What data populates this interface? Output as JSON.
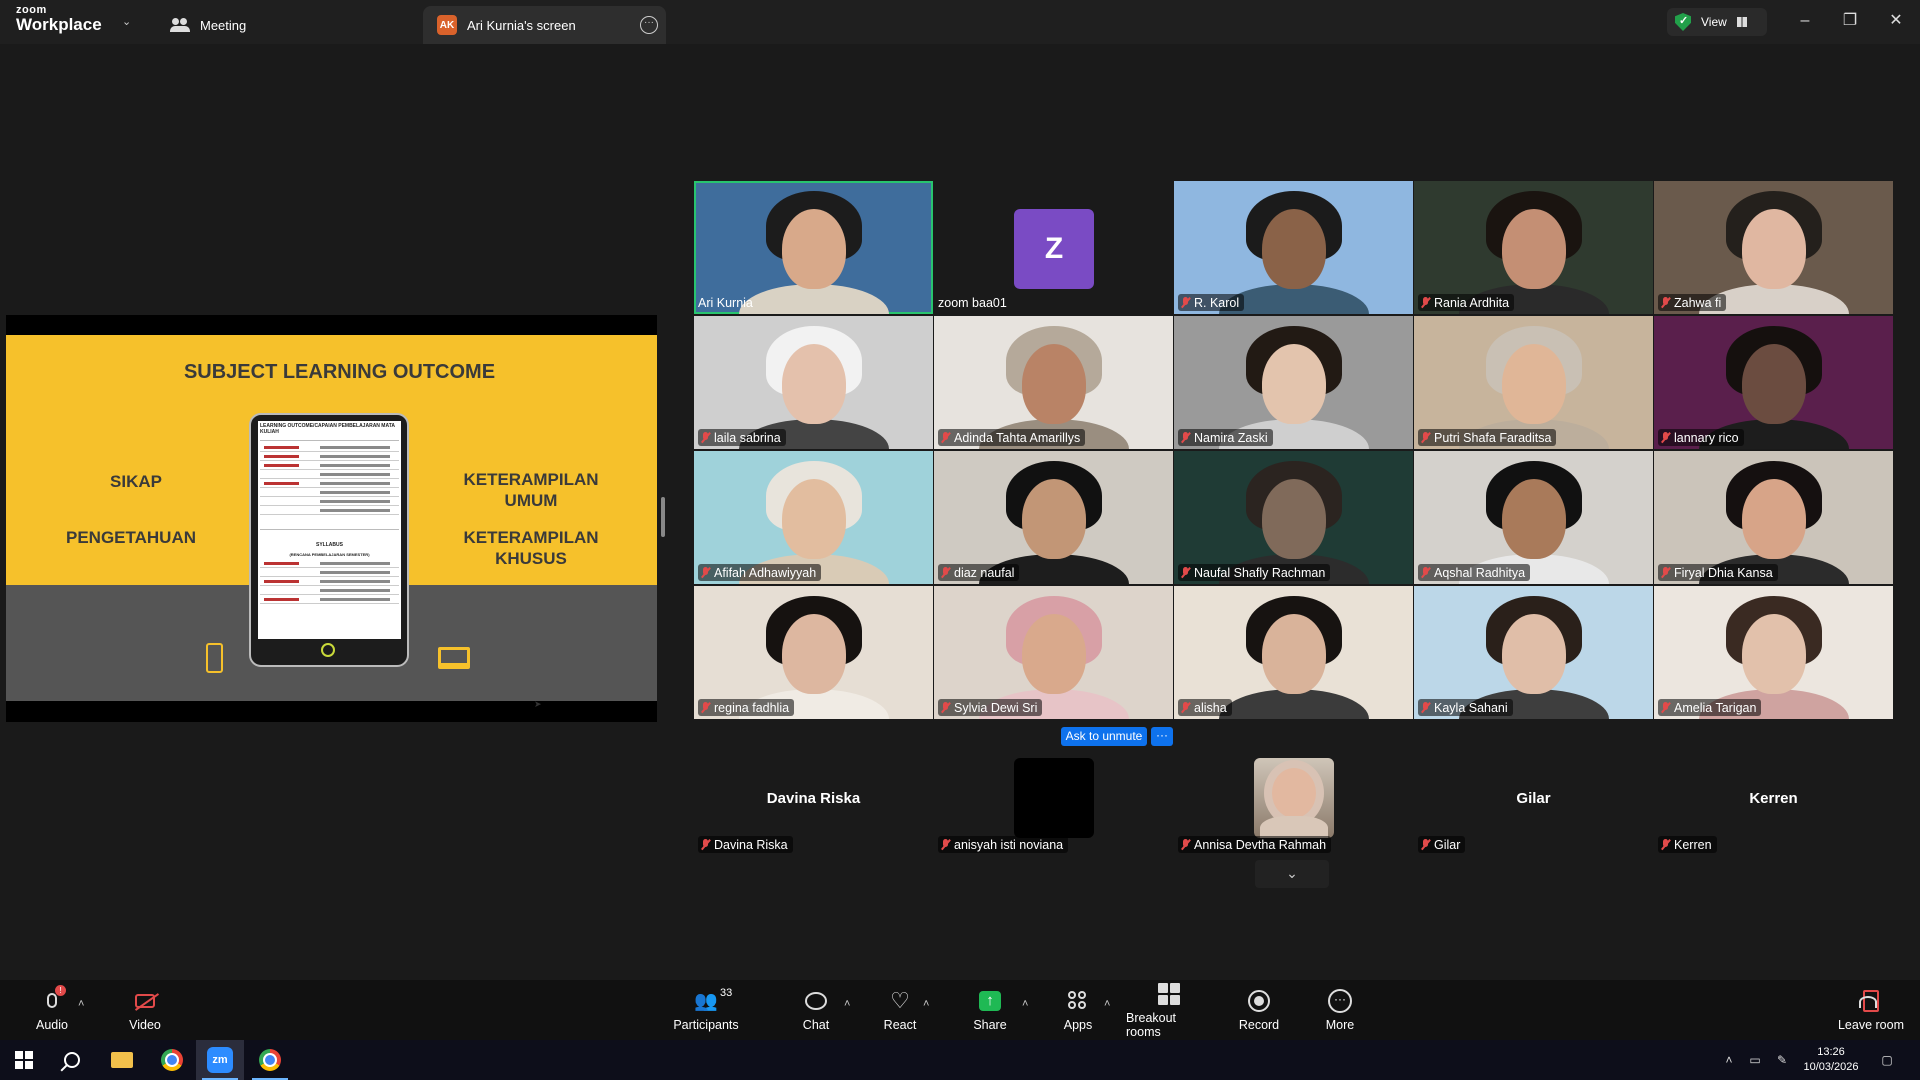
{
  "app": {
    "brand_top": "zoom",
    "brand_bottom": "Workplace",
    "tab_meeting": "Meeting",
    "tab_screen": "Ari Kurnia's screen",
    "screen_badge": "AK",
    "view_label": "View"
  },
  "slide": {
    "title": "SUBJECT LEARNING OUTCOME",
    "left_top": "SIKAP",
    "left_bottom": "PENGETAHUAN",
    "right_top": "KETERAMPILAN UMUM",
    "right_bottom": "KETERAMPILAN KHUSUS",
    "doc_header": "LEARNING OUTCOME/CAPAIAN PEMBELAJARAN MATA KULIAH",
    "doc_syllabus": "SYLLABUS",
    "doc_syllabus_sub": "(RENCANA PEMBELAJARAN SEMESTER)"
  },
  "gallery": [
    {
      "name": "Ari Kurnia",
      "muted": false,
      "active": true,
      "bg": "#3f6d9c",
      "skin": "#d8a98a",
      "hair": "#1c1c1c",
      "shirt": "#d9d2c4"
    },
    {
      "name": "zoom baa01",
      "muted": false,
      "avatar": "Z",
      "bg": "#1a1a1a"
    },
    {
      "name": "R. Karol",
      "muted": true,
      "bg": "#8fb7e0",
      "skin": "#8a6248",
      "hair": "#1b1b1b",
      "shirt": "#3b5c74"
    },
    {
      "name": "Rania Ardhita",
      "muted": true,
      "bg": "#2f3a2f",
      "skin": "#c48f74",
      "hair": "#1a1410",
      "shirt": "#2a2a2a"
    },
    {
      "name": "Zahwa fi",
      "muted": true,
      "bg": "#6a5a4c",
      "skin": "#e0b7a1",
      "hair": "#24201c",
      "shirt": "#d8d0c8"
    },
    {
      "name": "laila sabrina",
      "muted": true,
      "bg": "#cfcfcf",
      "skin": "#e4c1ac",
      "hair": "#f2f2f2",
      "shirt": "#444"
    },
    {
      "name": "Adinda Tahta Amarillys",
      "muted": true,
      "bg": "#e7e3de",
      "skin": "#b98366",
      "hair": "#b5a99a",
      "shirt": "#9a8e80"
    },
    {
      "name": "Namira Zaski",
      "muted": true,
      "bg": "#9a9a9a",
      "skin": "#e3c4ad",
      "hair": "#221a14",
      "shirt": "#cfcfcf"
    },
    {
      "name": "Putri Shafa Faraditsa",
      "muted": true,
      "bg": "#c7b49c",
      "skin": "#e0b697",
      "hair": "#c9c0b4",
      "shirt": "#bcae9c"
    },
    {
      "name": "lannary rico",
      "muted": true,
      "bg": "#5a1f4c",
      "skin": "#6b4c40",
      "hair": "#15100e",
      "shirt": "#1d1d1d"
    },
    {
      "name": "Afifah Adhawiyyah",
      "muted": true,
      "bg": "#9fd2da",
      "skin": "#e2bd9f",
      "hair": "#e8e4dc",
      "shirt": "#d9cbb6"
    },
    {
      "name": "diaz naufal",
      "muted": true,
      "bg": "#cfcac2",
      "skin": "#c29676",
      "hair": "#111",
      "shirt": "#1d1d1d"
    },
    {
      "name": "Naufal Shafly Rachman",
      "muted": true,
      "bg": "#1f3b35",
      "skin": "#806a5a",
      "hair": "#2b2420",
      "shirt": "#2c2c2c"
    },
    {
      "name": "Aqshal Radhitya",
      "muted": true,
      "bg": "#d4d1cc",
      "skin": "#a97a5a",
      "hair": "#111",
      "shirt": "#e8e8e8"
    },
    {
      "name": "Firyal Dhia Kansa",
      "muted": true,
      "bg": "#cbc4ba",
      "skin": "#d7a488",
      "hair": "#151010",
      "shirt": "#2b2b2b"
    },
    {
      "name": "regina fadhlia",
      "muted": true,
      "bg": "#e6ded4",
      "skin": "#ddb7a0",
      "hair": "#161210",
      "shirt": "#f0ebe4"
    },
    {
      "name": "Sylvia Dewi Sri",
      "muted": true,
      "bg": "#ddd4cb",
      "skin": "#d9a98c",
      "hair": "#d8a0a6",
      "shirt": "#e7c4c7"
    },
    {
      "name": "alisha",
      "muted": true,
      "bg": "#e9e1d6",
      "skin": "#d9b39a",
      "hair": "#171311",
      "shirt": "#3b3b3b"
    },
    {
      "name": "Kayla Sahani",
      "muted": true,
      "bg": "#bcd7e8",
      "skin": "#e0bea8",
      "hair": "#2a201a",
      "shirt": "#3e3e3e"
    },
    {
      "name": "Amelia Tarigan",
      "muted": true,
      "bg": "#ece6df",
      "skin": "#e2c1ab",
      "hair": "#3a2a22",
      "shirt": "#cfa3a0"
    }
  ],
  "others": [
    {
      "name": "Davina Riska",
      "bigname": "Davina Riska",
      "kind": "name"
    },
    {
      "name": "anisyah isti noviana",
      "kind": "black"
    },
    {
      "name": "Annisa Devtha Rahmah",
      "kind": "photo"
    },
    {
      "name": "Gilar",
      "bigname": "Gilar",
      "kind": "name"
    },
    {
      "name": "Kerren",
      "bigname": "Kerren",
      "kind": "name"
    }
  ],
  "ask_unmute": "Ask to unmute",
  "ask_more": "···",
  "toolbar": {
    "audio": "Audio",
    "audio_badge": "!",
    "video": "Video",
    "participants": "Participants",
    "participants_count": "33",
    "chat": "Chat",
    "react": "React",
    "share": "Share",
    "apps": "Apps",
    "breakout": "Breakout rooms",
    "record": "Record",
    "more": "More",
    "leave": "Leave room"
  },
  "taskbar": {
    "zoom_label": "zm",
    "time": "13:26",
    "date": "10/03/2026"
  },
  "colors": {
    "accent": "#0e72ed",
    "muted_red": "#e24a4a",
    "active_speaker": "#28c46f",
    "slide_yellow": "#f6c12b"
  }
}
